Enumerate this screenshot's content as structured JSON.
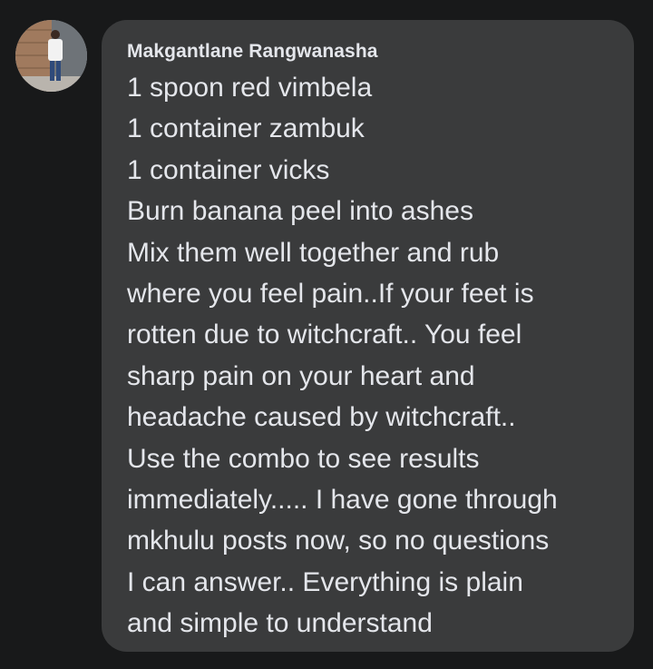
{
  "comment": {
    "author": "Makgantlane Rangwanasha",
    "avatar_icon": "profile-photo",
    "lines": [
      "1 spoon red vimbela",
      "1 container zambuk",
      "1 container vicks",
      "Burn banana peel into ashes",
      "Mix them well together and rub",
      "where you feel pain..If your feet is",
      "rotten due to witchcraft.. You feel",
      "sharp pain on your heart and",
      "headache caused by witchcraft..",
      "Use the combo to see results",
      "immediately..... I have gone through",
      "mkhulu posts now, so no questions",
      "I can answer.. Everything is plain",
      "and simple to understand"
    ]
  },
  "colors": {
    "background": "#18191a",
    "bubble": "#3a3b3c",
    "text": "#e4e6eb"
  }
}
